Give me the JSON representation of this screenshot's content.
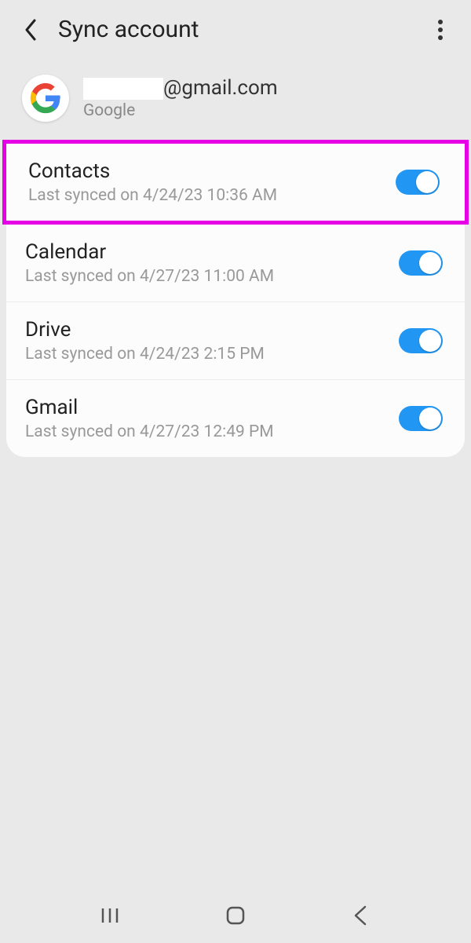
{
  "header": {
    "title": "Sync account"
  },
  "account": {
    "email_suffix": "@gmail.com",
    "provider": "Google"
  },
  "sync_items": [
    {
      "name": "Contacts",
      "detail": "Last synced on 4/24/23  10:36 AM",
      "on": true,
      "highlighted": true
    },
    {
      "name": "Calendar",
      "detail": "Last synced on 4/27/23  11:00 AM",
      "on": true,
      "highlighted": false
    },
    {
      "name": "Drive",
      "detail": "Last synced on 4/24/23  2:15 PM",
      "on": true,
      "highlighted": false
    },
    {
      "name": "Gmail",
      "detail": "Last synced on 4/27/23  12:49 PM",
      "on": true,
      "highlighted": false
    }
  ]
}
